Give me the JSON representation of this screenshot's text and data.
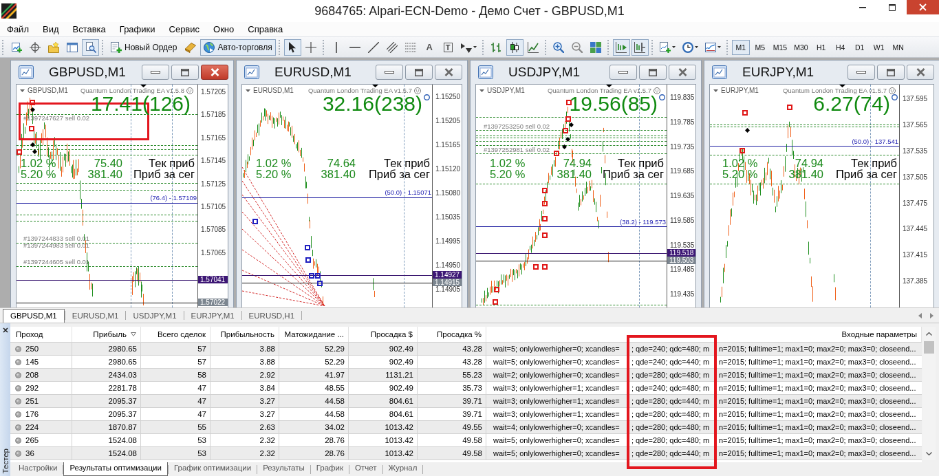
{
  "window": {
    "title": "9684765: Alpari-ECN-Demo - Демо Счет - GBPUSD,M1"
  },
  "menu": [
    "Файл",
    "Вид",
    "Вставка",
    "Графики",
    "Сервис",
    "Окно",
    "Справка"
  ],
  "toolbar": [
    {
      "items": [
        {
          "kind": "icon",
          "selected": false,
          "menu": false
        },
        {
          "kind": "icon",
          "selected": false,
          "menu": false
        },
        {
          "kind": "icon",
          "selected": false,
          "menu": false
        },
        {
          "kind": "icon",
          "selected": false,
          "menu": false
        },
        {
          "kind": "icon",
          "selected": true,
          "menu": false
        }
      ]
    },
    {
      "items": [
        {
          "kind": "labeled",
          "label": "Новый Ордер",
          "selected": false,
          "menu": false
        },
        {
          "kind": "icon",
          "selected": false,
          "menu": false
        },
        {
          "kind": "labeled",
          "label": "Авто-торговля",
          "selected": true,
          "menu": false
        }
      ]
    },
    {
      "items": [
        {
          "kind": "icon",
          "selected": true,
          "menu": false
        },
        {
          "kind": "icon",
          "selected": false,
          "menu": false
        }
      ]
    },
    {
      "items": [
        {
          "kind": "icon",
          "selected": false,
          "menu": false
        },
        {
          "kind": "icon",
          "selected": false,
          "menu": false
        },
        {
          "kind": "icon",
          "selected": false,
          "menu": false
        },
        {
          "kind": "icon",
          "selected": false,
          "menu": false
        },
        {
          "kind": "icon",
          "selected": false,
          "menu": false
        },
        {
          "kind": "glyph",
          "label": "A",
          "selected": false,
          "menu": false
        },
        {
          "kind": "boxed-glyph",
          "label": "T",
          "selected": false,
          "menu": false
        },
        {
          "kind": "icon",
          "selected": false,
          "menu": true
        }
      ]
    },
    {
      "items": [
        {
          "kind": "icon",
          "selected": false,
          "menu": false
        },
        {
          "kind": "icon",
          "selected": true,
          "menu": false
        },
        {
          "kind": "icon",
          "selected": false,
          "menu": false
        }
      ]
    },
    {
      "items": [
        {
          "kind": "icon",
          "selected": false,
          "menu": false
        },
        {
          "kind": "icon",
          "selected": false,
          "menu": false
        },
        {
          "kind": "icon",
          "selected": false,
          "menu": false
        }
      ]
    },
    {
      "items": [
        {
          "kind": "icon",
          "selected": true,
          "menu": false
        },
        {
          "kind": "icon",
          "selected": true,
          "menu": false
        }
      ]
    },
    {
      "items": [
        {
          "kind": "icon",
          "selected": false,
          "menu": true
        },
        {
          "kind": "icon",
          "selected": false,
          "menu": true
        },
        {
          "kind": "icon",
          "selected": false,
          "menu": true
        }
      ]
    },
    {
      "items": [
        {
          "kind": "text",
          "label": "M1",
          "selected": true,
          "menu": false
        },
        {
          "kind": "text",
          "label": "M5",
          "selected": false,
          "menu": false
        },
        {
          "kind": "text",
          "label": "M15",
          "selected": false,
          "menu": false
        },
        {
          "kind": "text",
          "label": "M30",
          "selected": false,
          "menu": false
        },
        {
          "kind": "text",
          "label": "H1",
          "selected": false,
          "menu": false
        },
        {
          "kind": "text",
          "label": "H4",
          "selected": false,
          "menu": false
        },
        {
          "kind": "text",
          "label": "D1",
          "selected": false,
          "menu": false
        },
        {
          "kind": "text",
          "label": "W1",
          "selected": false,
          "menu": false
        },
        {
          "kind": "text",
          "label": "MN",
          "selected": false,
          "menu": false
        }
      ]
    }
  ],
  "charts": [
    {
      "title": "GBPUSD,M1",
      "active": true,
      "symbol": "GBPUSD,M1",
      "expert": "Quantum London Trading EA v1.5.8",
      "profit": "17.41(126)",
      "stats": [
        {
          "percent": "1.02 %",
          "value": "75.40",
          "label": "Тек приб"
        },
        {
          "percent": "5.20 %",
          "value": "381.40",
          "label": "Приб за сег"
        }
      ],
      "fib_label": "(76.4) - 1.57109",
      "orders": [
        "#1397247627 sell 0.02",
        "#1397244833 sell 0.01",
        "#1397244983 sell 0.01",
        "#1397244605 sell 0.01"
      ],
      "price_axis": [
        "1.57205",
        "1.57185",
        "1.57165",
        "1.57145",
        "1.57125",
        "1.57105",
        "1.57085",
        "1.57065"
      ],
      "price_badges": [
        {
          "text": "1.57041",
          "color": "#3d1775"
        },
        {
          "text": "1.57022",
          "color": "#7c8690"
        }
      ]
    },
    {
      "title": "EURUSD,M1",
      "active": false,
      "symbol": "EURUSD,M1",
      "expert": "Quantum London Trading EA v1.5.7",
      "profit": "32.16(238)",
      "stats": [
        {
          "percent": "1.02 %",
          "value": "74.64",
          "label": "Тек приб"
        },
        {
          "percent": "5.20 %",
          "value": "381.40",
          "label": "Приб за сег"
        }
      ],
      "fib_label": "(50.0) - 1.15071",
      "price_axis": [
        "1.15250",
        "1.15205",
        "1.15165",
        "1.15120",
        "1.15080",
        "1.15035",
        "1.14995",
        "1.14950",
        "1.14905"
      ],
      "price_badges": [
        {
          "text": "1.14927",
          "color": "#3d1775"
        },
        {
          "text": "1.14915",
          "color": "#7c8690"
        }
      ]
    },
    {
      "title": "USDJPY,M1",
      "active": false,
      "symbol": "USDJPY,M1",
      "expert": "Quantum London Trading EA v1.5.7",
      "profit": "19.56(85)",
      "stats": [
        {
          "percent": "1.02 %",
          "value": "74.94",
          "label": "Тек приб"
        },
        {
          "percent": "5.20 %",
          "value": "381.40",
          "label": "Приб за сег"
        }
      ],
      "fib_label": "(38.2) - 119.573",
      "orders": [
        "#1397253250 sell 0.02",
        "#1397252981 sell 0.02"
      ],
      "price_axis": [
        "119.835",
        "119.785",
        "119.735",
        "119.685",
        "119.635",
        "119.585",
        "119.535",
        "119.485",
        "119.435"
      ],
      "price_badges": [
        {
          "text": "119.518",
          "color": "#3d1775"
        },
        {
          "text": "119.503",
          "color": "#7c8690"
        }
      ]
    },
    {
      "title": "EURJPY,M1",
      "active": false,
      "symbol": "EURJPY,M1",
      "expert": "Quantum London Trading EA v1.5.7",
      "profit": "6.27(74)",
      "stats": [
        {
          "percent": "1.02 %",
          "value": "74.94",
          "label": "Тек приб"
        },
        {
          "percent": "5.20 %",
          "value": "381.40",
          "label": "Приб за сег"
        }
      ],
      "fib_label": "(50.0) - 137.541",
      "price_axis": [
        "137.595",
        "137.565",
        "137.535",
        "137.505",
        "137.475",
        "137.445",
        "137.415",
        "137.385"
      ]
    }
  ],
  "chart_tabs": [
    {
      "label": "GBPUSD,M1",
      "selected": true
    },
    {
      "label": "EURUSD,M1",
      "selected": false
    },
    {
      "label": "USDJPY,M1",
      "selected": false
    },
    {
      "label": "EURJPY,M1",
      "selected": false
    },
    {
      "label": "EURUSD,H1",
      "selected": false
    }
  ],
  "tester": {
    "title": "Тестер",
    "columns": [
      {
        "label": "Проход",
        "sorted": false
      },
      {
        "label": "Прибыль",
        "sorted": true
      },
      {
        "label": "Всего сделок",
        "sorted": false
      },
      {
        "label": "Прибыльность",
        "sorted": false
      },
      {
        "label": "Матожидание ...",
        "sorted": false
      },
      {
        "label": "Просадка $",
        "sorted": false
      },
      {
        "label": "Просадка %",
        "sorted": false
      },
      {
        "label": "Входные параметры",
        "sorted": false
      }
    ],
    "rows": [
      {
        "cells": [
          "250",
          "2980.65",
          "57",
          "3.88",
          "52.29",
          "902.49",
          "43.28"
        ],
        "params": [
          "wait=5; onlylowerhigher=0; xcandles=",
          "; qde=240; qdc=480; m",
          "n=2015; fulltime=1; max1=0; max2=0; max3=0; closeend..."
        ]
      },
      {
        "cells": [
          "145",
          "2980.65",
          "57",
          "3.88",
          "52.29",
          "902.49",
          "43.28"
        ],
        "params": [
          "wait=5; onlylowerhigher=0; xcandles=",
          "; qde=240; qdc=440; m",
          "n=2015; fulltime=1; max1=0; max2=0; max3=0; closeend..."
        ]
      },
      {
        "cells": [
          "208",
          "2434.03",
          "58",
          "2.92",
          "41.97",
          "1131.21",
          "55.23"
        ],
        "params": [
          "wait=2; onlylowerhigher=0; xcandles=",
          "; qde=280; qdc=480; m",
          "n=2015; fulltime=1; max1=0; max2=0; max3=0; closeend..."
        ]
      },
      {
        "cells": [
          "292",
          "2281.78",
          "47",
          "3.84",
          "48.55",
          "902.49",
          "35.73"
        ],
        "params": [
          "wait=3; onlylowerhigher=1; xcandles=",
          "; qde=240; qdc=480; m",
          "n=2015; fulltime=1; max1=0; max2=0; max3=0; closeend..."
        ]
      },
      {
        "cells": [
          "251",
          "2095.37",
          "47",
          "3.27",
          "44.58",
          "804.61",
          "39.71"
        ],
        "params": [
          "wait=3; onlylowerhigher=1; xcandles=",
          "; qde=280; qdc=440; m",
          "n=2015; fulltime=1; max1=0; max2=0; max3=0; closeend..."
        ]
      },
      {
        "cells": [
          "176",
          "2095.37",
          "47",
          "3.27",
          "44.58",
          "804.61",
          "39.71"
        ],
        "params": [
          "wait=3; onlylowerhigher=1; xcandles=",
          "; qde=280; qdc=480; m",
          "n=2015; fulltime=1; max1=0; max2=0; max3=0; closeend..."
        ]
      },
      {
        "cells": [
          "224",
          "1870.87",
          "55",
          "2.63",
          "34.02",
          "1013.42",
          "49.55"
        ],
        "params": [
          "wait=4; onlylowerhigher=0; xcandles=",
          "; qde=280; qdc=480; m",
          "n=2015; fulltime=1; max1=0; max2=0; max3=0; closeend..."
        ]
      },
      {
        "cells": [
          "265",
          "1524.08",
          "53",
          "2.32",
          "28.76",
          "1013.42",
          "49.58"
        ],
        "params": [
          "wait=5; onlylowerhigher=0; xcandles=",
          "; qde=280; qdc=480; m",
          "n=2015; fulltime=1; max1=0; max2=0; max3=0; closeend..."
        ]
      },
      {
        "cells": [
          "36",
          "1524.08",
          "53",
          "2.32",
          "28.76",
          "1013.42",
          "49.58"
        ],
        "params": [
          "wait=5; onlylowerhigher=0; xcandles=",
          "; qde=280; qdc=440; m",
          "n=2015; fulltime=1; max1=0; max2=0; max3=0; closeend..."
        ]
      }
    ],
    "tabs": [
      {
        "label": "Настройки",
        "selected": false
      },
      {
        "label": "Результаты оптимизации",
        "selected": true
      },
      {
        "label": "График оптимизации",
        "selected": false
      },
      {
        "label": "Результаты",
        "selected": false
      },
      {
        "label": "График",
        "selected": false
      },
      {
        "label": "Отчет",
        "selected": false
      },
      {
        "label": "Журнал",
        "selected": false
      }
    ]
  }
}
